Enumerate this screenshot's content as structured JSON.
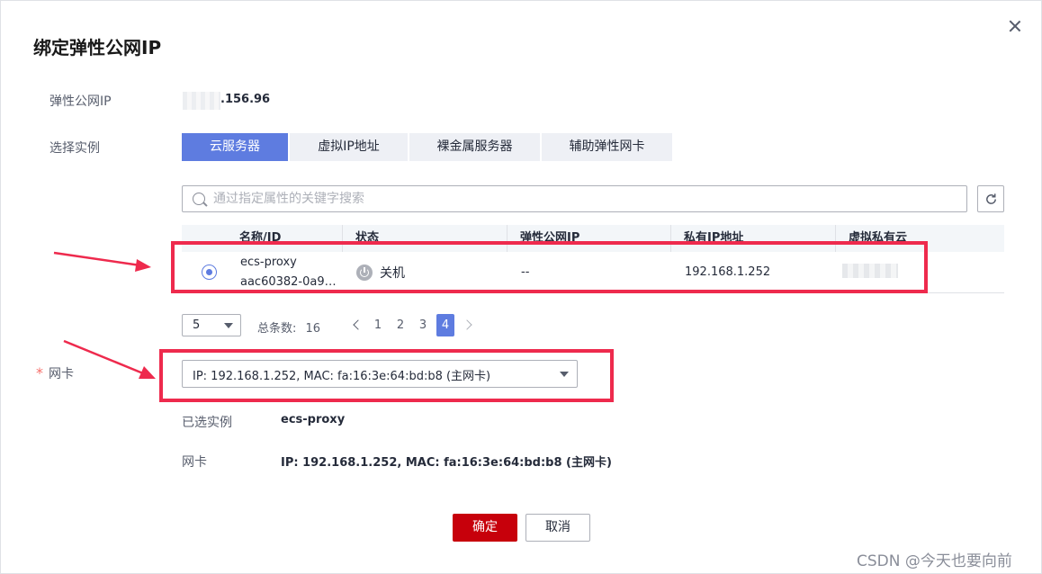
{
  "dialog": {
    "title": "绑定弹性公网IP",
    "close_icon": "close-icon"
  },
  "eip": {
    "label": "弹性公网IP",
    "value": ".156.96"
  },
  "instance": {
    "label": "选择实例",
    "tabs": [
      {
        "label": "云服务器",
        "active": true
      },
      {
        "label": "虚拟IP地址",
        "active": false
      },
      {
        "label": "裸金属服务器",
        "active": false
      },
      {
        "label": "辅助弹性网卡",
        "active": false
      }
    ]
  },
  "search": {
    "placeholder": "通过指定属性的关键字搜索",
    "icon": "search-icon",
    "refresh_icon": "refresh-icon"
  },
  "table": {
    "columns": [
      "名称/ID",
      "状态",
      "弹性公网IP",
      "私有IP地址",
      "虚拟私有云"
    ],
    "rows": [
      {
        "selected": true,
        "name": "ecs-proxy",
        "id": "aac60382-0a9…",
        "status": "关机",
        "status_icon": "power-icon",
        "eip": "--",
        "private_ip": "192.168.1.252",
        "vpc": ""
      }
    ]
  },
  "pagination": {
    "page_size": "5",
    "total_label": "总条数:",
    "total": "16",
    "pages": [
      "1",
      "2",
      "3",
      "4"
    ],
    "current_page": "4"
  },
  "nic": {
    "label": "网卡",
    "required_mark": "*",
    "selected": "IP: 192.168.1.252, MAC: fa:16:3e:64:bd:b8 (主网卡)"
  },
  "summary": {
    "instance_label": "已选实例",
    "instance_value": "ecs-proxy",
    "nic_label": "网卡",
    "nic_value": "IP: 192.168.1.252, MAC: fa:16:3e:64:bd:b8 (主网卡)"
  },
  "buttons": {
    "ok": "确定",
    "cancel": "取消"
  },
  "annotations": {
    "highlight_color": "#ee2a4d"
  },
  "watermark": "CSDN @今天也要向前",
  "colors": {
    "primary": "#5e7ce0",
    "confirm": "#c7000b"
  }
}
